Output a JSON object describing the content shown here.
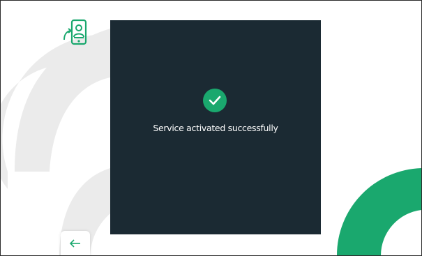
{
  "dialog": {
    "message": "Service activated successfully",
    "status_icon": "check-icon",
    "status_color": "#1aa86e"
  },
  "header": {
    "app_icon": "video-intercom-icon"
  },
  "footer": {
    "back_icon": "arrow-left-icon"
  },
  "colors": {
    "accent": "#1aa86e",
    "panel_background": "#1b2a33",
    "decor_gray": "#ebebeb",
    "background": "#ffffff"
  }
}
